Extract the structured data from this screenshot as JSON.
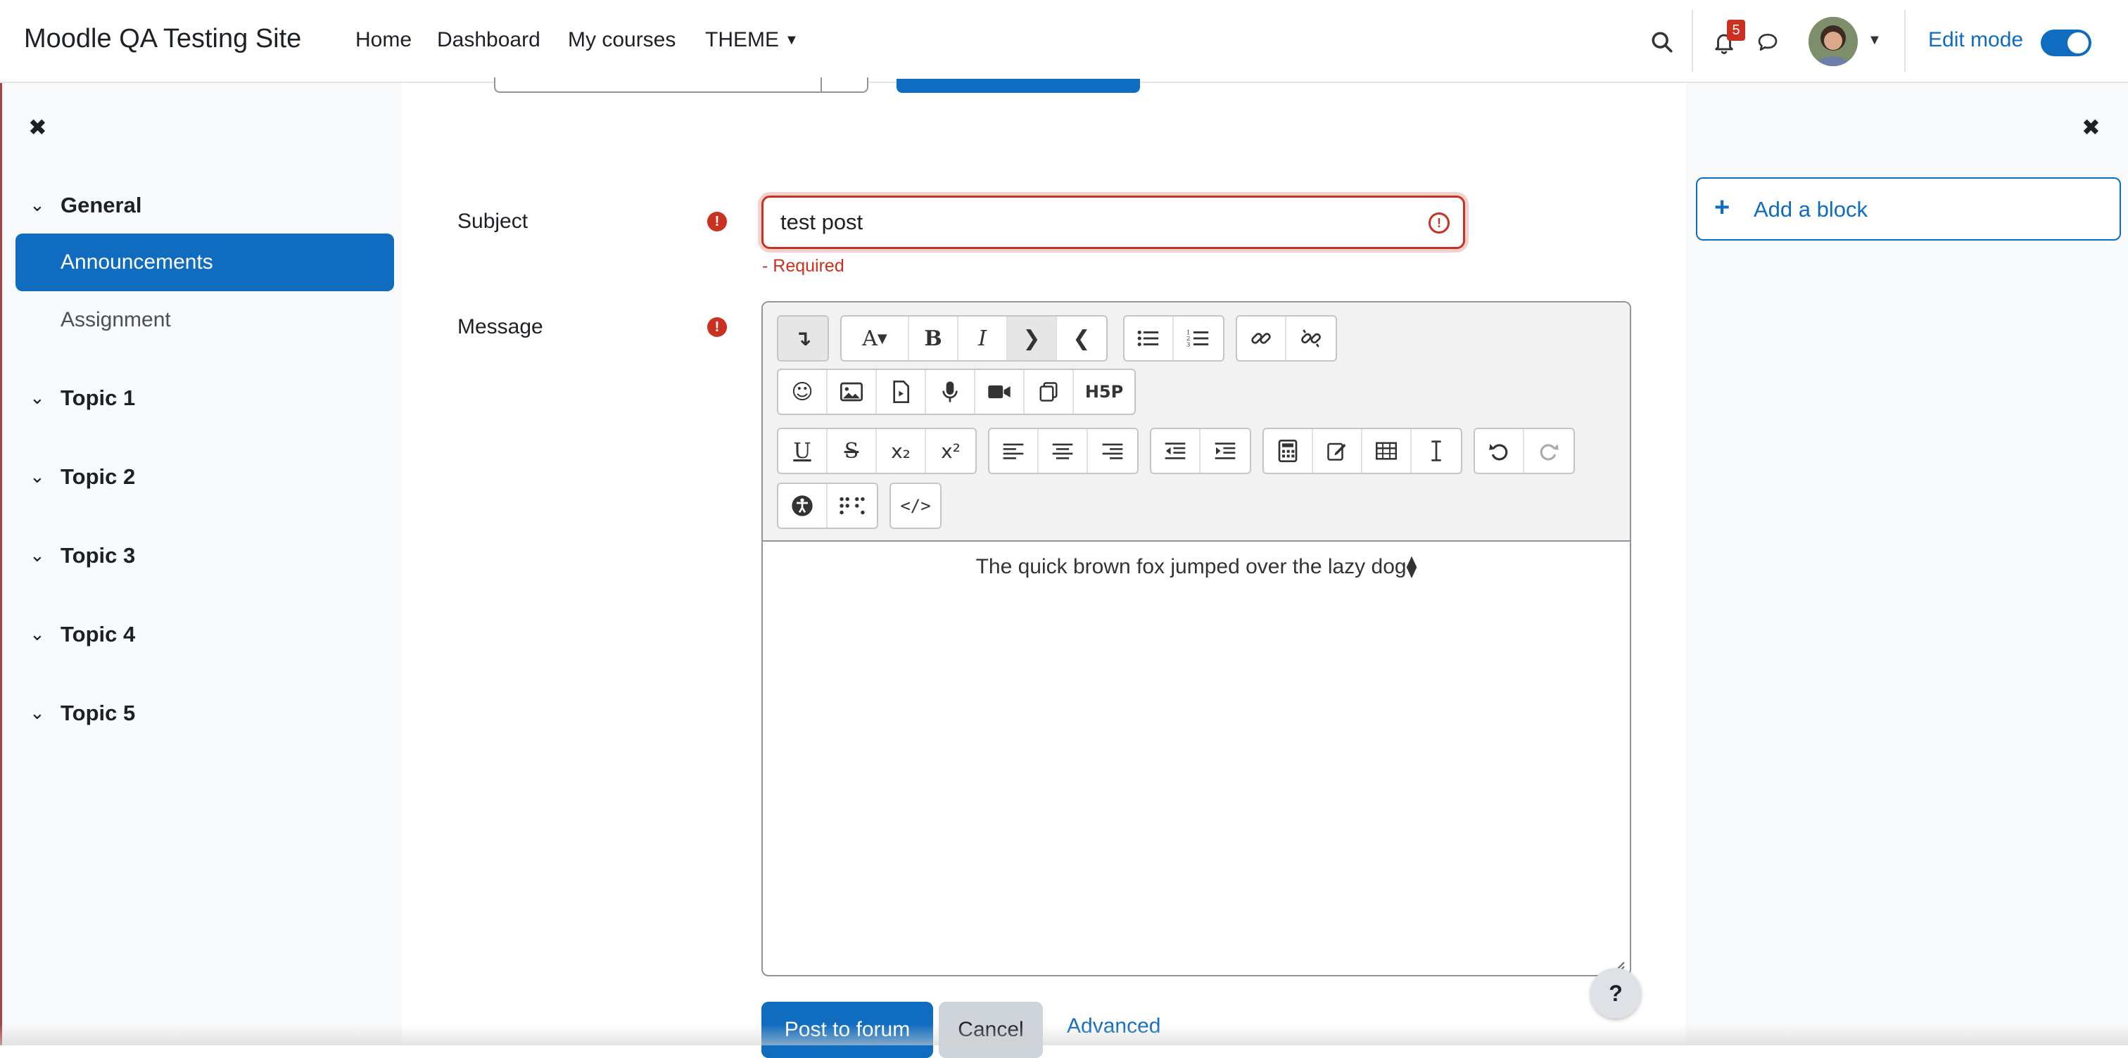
{
  "navbar": {
    "site_name": "Moodle QA Testing Site",
    "links": [
      "Home",
      "Dashboard",
      "My courses",
      "THEME"
    ],
    "notification_count": "5",
    "edit_mode_label": "Edit mode",
    "edit_mode_on": true,
    "accent_color": "#0f6cbf"
  },
  "left_drawer": {
    "close_icon": "close-icon",
    "sections": [
      {
        "label": "General",
        "items": [
          "Announcements",
          "Assignment"
        ]
      },
      {
        "label": "Topic 1"
      },
      {
        "label": "Topic 2"
      },
      {
        "label": "Topic 3"
      },
      {
        "label": "Topic 4"
      },
      {
        "label": "Topic 5"
      }
    ],
    "active_item": "Announcements"
  },
  "right_drawer": {
    "add_block_label": "Add a block"
  },
  "form": {
    "subject_label": "Subject",
    "subject_value": "test post",
    "subject_error": "- Required",
    "message_label": "Message",
    "message_content": "The quick brown fox jumped over the lazy dog⧫",
    "error_color": "#ca3120"
  },
  "toolbar_icons": {
    "row1": [
      "toggle-toolbar-icon",
      "font-style-icon",
      "bold-icon",
      "italic-icon",
      "indent-icon",
      "outdent-icon",
      "bullet-list-icon",
      "numbered-list-icon",
      "link-icon",
      "unlink-icon"
    ],
    "row2": [
      "emoji-icon",
      "image-icon",
      "media-icon",
      "record-audio-icon",
      "record-video-icon",
      "manage-files-icon",
      "h5p-icon"
    ],
    "row3": [
      "underline-icon",
      "strikethrough-icon",
      "subscript-icon",
      "superscript-icon",
      "align-left-icon",
      "align-center-icon",
      "align-right-icon",
      "decrease-indent-icon",
      "increase-indent-icon",
      "equation-icon",
      "edit-chart-icon",
      "table-icon",
      "clear-format-icon",
      "undo-icon",
      "redo-icon"
    ],
    "row4": [
      "accessibility-checker-icon",
      "screenreader-helper-icon",
      "html-icon"
    ],
    "h5p_label": "H5P",
    "bold_glyph": "B",
    "italic_glyph": "I",
    "underline_glyph": "U",
    "strike_glyph": "S",
    "sub_glyph": "x₂",
    "sup_glyph": "x²",
    "font_glyph": "A",
    "html_glyph": "</>"
  },
  "actions": {
    "post_label": "Post to forum",
    "cancel_label": "Cancel",
    "advanced_label": "Advanced",
    "help_label": "?"
  }
}
